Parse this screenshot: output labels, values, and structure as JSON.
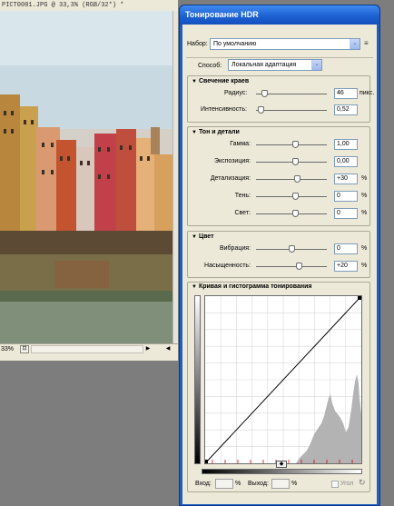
{
  "document": {
    "title": "PICT0001.JPG @ 33,3% (RGB/32*) *",
    "zoom": "33%",
    "status_button": "⊡",
    "scroll_left": "◀",
    "scroll_right": "▶"
  },
  "dialog": {
    "title": "Тонирование HDR",
    "preset_label": "Набор:",
    "preset_value": "По умолчанию",
    "preset_menu": "≡",
    "method_label": "Способ:",
    "method_value": "Локальная адаптация",
    "dropdown_arrow": "⌄",
    "collapse_arrow": "▼",
    "edge_glow": {
      "heading": "Свечение краев",
      "radius_label": "Радиус:",
      "radius_value": "46",
      "radius_unit": "пикс.",
      "radius_pos": 0.12,
      "strength_label": "Интенсивность:",
      "strength_value": "0,52",
      "strength_pos": 0.06
    },
    "tone_detail": {
      "heading": "Тон и детали",
      "rows": [
        {
          "label": "Гамма:",
          "value": "1,00",
          "unit": "",
          "pos": 0.55
        },
        {
          "label": "Экспозиция:",
          "value": "0,00",
          "unit": "",
          "pos": 0.55
        },
        {
          "label": "Детализация:",
          "value": "+30",
          "unit": "%",
          "pos": 0.58
        },
        {
          "label": "Тень:",
          "value": "0",
          "unit": "%",
          "pos": 0.55
        },
        {
          "label": "Свет:",
          "value": "0",
          "unit": "%",
          "pos": 0.55
        }
      ]
    },
    "color": {
      "heading": "Цвет",
      "rows": [
        {
          "label": "Вибрация:",
          "value": "0",
          "unit": "%",
          "pos": 0.5
        },
        {
          "label": "Насыщенность:",
          "value": "+20",
          "unit": "%",
          "pos": 0.6
        }
      ]
    },
    "curve": {
      "heading": "Кривая и гистограмма тонирования",
      "center_marker": "◆",
      "input_label": "Вход:",
      "input_value": "",
      "input_unit": "%",
      "output_label": "Выход:",
      "output_value": "",
      "output_unit": "%",
      "corner_label": "Угол",
      "reset_glyph": "↻"
    }
  }
}
